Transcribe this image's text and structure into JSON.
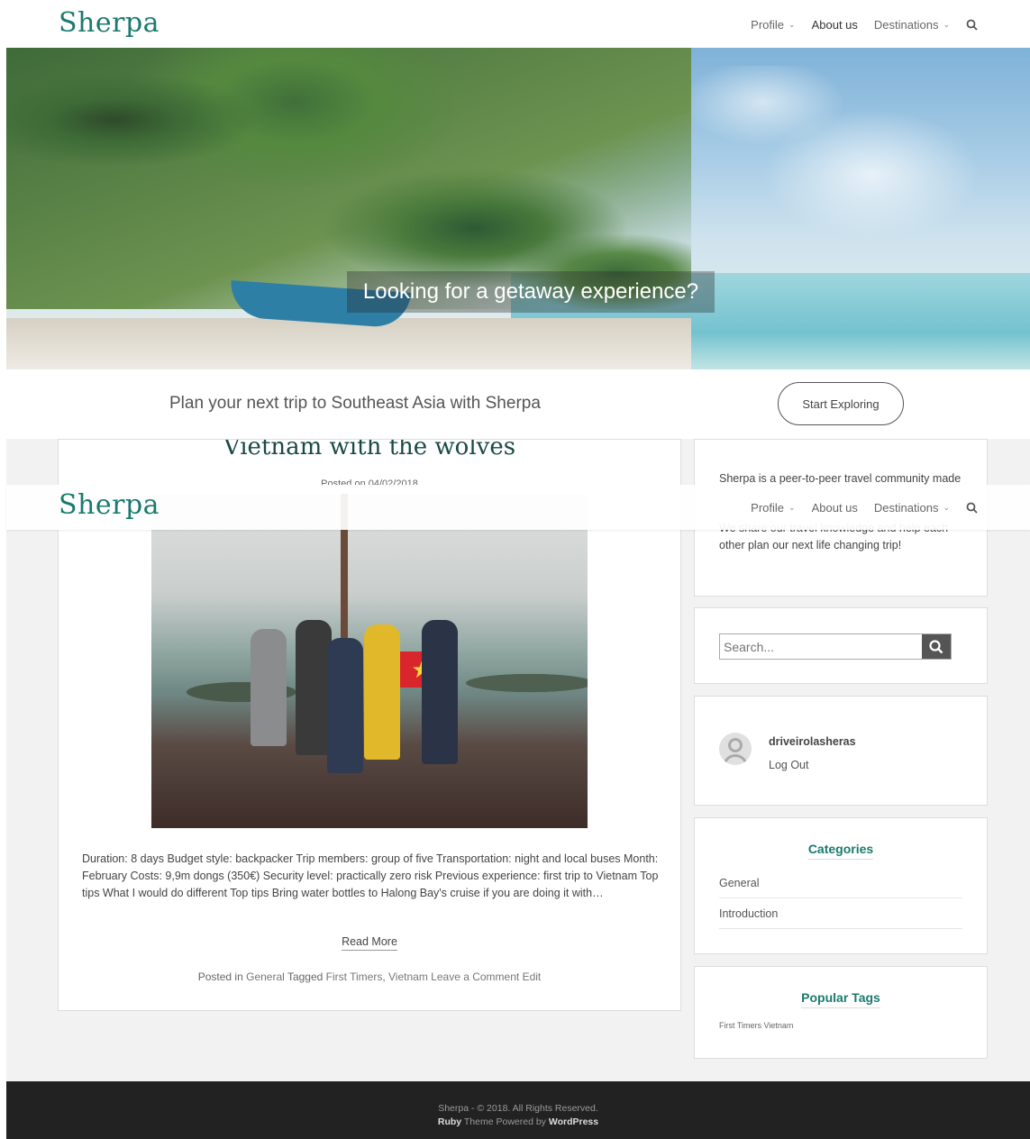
{
  "brand": "Sherpa",
  "nav": {
    "items": [
      {
        "label": "Profile",
        "chevron": true
      },
      {
        "label": "About us",
        "chevron": false
      },
      {
        "label": "Destinations",
        "chevron": true
      }
    ],
    "search_icon": "search-icon"
  },
  "hero": {
    "caption": "Looking for a getaway experience?"
  },
  "cta": {
    "text": "Plan your next trip to Southeast Asia with Sherpa",
    "button": "Start Exploring"
  },
  "post": {
    "title": "Vietnam with the wolves",
    "date": "Posted on 04/02/2018",
    "excerpt": "Duration: 8 days Budget style: backpacker Trip members: group of five Transportation: night and local buses Month: February Costs: 9,9m dongs (350€) Security level: practically zero risk Previous experience: first trip to Vietnam Top tips What I would do different Top tips Bring water bottles to Halong Bay's cruise if you are doing it with…",
    "read_more": "Read More",
    "meta": {
      "posted_in": "Posted in",
      "category": "General",
      "tagged": "Tagged",
      "tag1": "First Timers",
      "sep": ",",
      "tag2": "Vietnam",
      "comment": "Leave a Comment",
      "edit": "Edit"
    }
  },
  "sidebar": {
    "about_line1": "Sherpa is a peer-to-peer travel community made",
    "about_line2": "We share our travel knowledge and help each",
    "about_line3": "other plan our next life changing trip!",
    "search_placeholder": "Search...",
    "user": "driveirolasheras",
    "logout": "Log Out",
    "categories_title": "Categories",
    "categories": [
      "General",
      "Introduction"
    ],
    "tags_title": "Popular Tags",
    "tags": "First Timers Vietnam"
  },
  "footer": {
    "line1": "Sherpa - © 2018. All Rights Reserved.",
    "ruby": "Ruby",
    "theme": "Theme Powered by",
    "wp": "WordPress"
  }
}
